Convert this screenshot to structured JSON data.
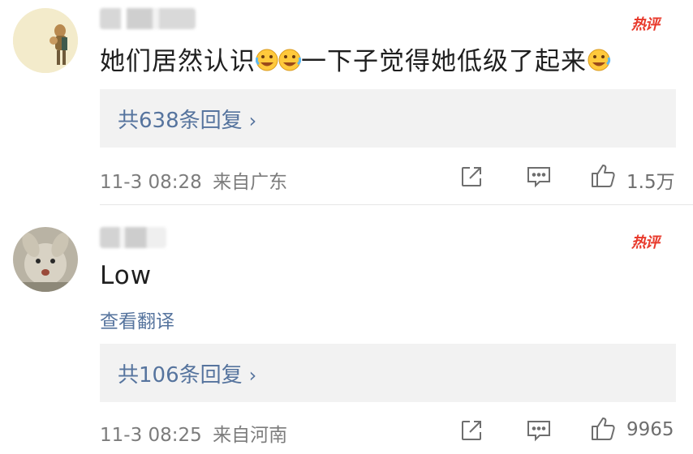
{
  "comments": [
    {
      "hot_label": "热评",
      "text_before": "她们居然认识",
      "text_middle": "一下子觉得她低级了起来",
      "replies_label": "共638条回复",
      "timestamp": "11-3 08:28",
      "location": "来自广东",
      "like_count": "1.5万",
      "icons": [
        "share-icon",
        "comment-icon",
        "like-icon"
      ]
    },
    {
      "hot_label": "热评",
      "text": "Low",
      "translate_label": "查看翻译",
      "replies_label": "共106条回复",
      "timestamp": "11-3 08:25",
      "location": "来自河南",
      "like_count": "9965",
      "icons": [
        "share-icon",
        "comment-icon",
        "like-icon"
      ]
    }
  ],
  "colors": {
    "hot_badge": "#e8392b",
    "link": "#56749e",
    "meta": "#7c7c7c",
    "reply_box": "#f2f2f2"
  }
}
